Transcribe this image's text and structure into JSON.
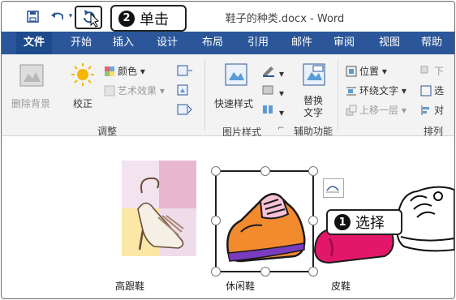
{
  "title_bar": {
    "doc_title": "鞋子的种类.docx - Word",
    "callout_click_num": "2",
    "callout_click_text": "单击"
  },
  "tabs": [
    "文件",
    "开始",
    "插入",
    "设计",
    "布局",
    "引用",
    "邮件",
    "审阅",
    "视图",
    "帮助"
  ],
  "ribbon": {
    "remove_bg": "删除背景",
    "corrections": "校正",
    "color": "颜色",
    "artistic_effects": "艺术效果",
    "quick_styles": "快速样式",
    "alt_text_line1": "替换",
    "alt_text_line2": "文字",
    "position": "位置",
    "wrap_text": "环绕文字",
    "bring_forward": "上移一层",
    "next_cut_1": "下",
    "next_cut_2": "选",
    "next_cut_3": "对",
    "group_adjust": "调整",
    "group_picture_styles": "图片样式",
    "group_accessibility": "辅助功能",
    "group_arrange": "排列"
  },
  "content": {
    "caption_high_heel": "高跟鞋",
    "caption_casual": "休闲鞋",
    "caption_leather": "皮鞋",
    "callout_select_num": "1",
    "callout_select_text": "选择"
  },
  "colors": {
    "accent": "#2b579a",
    "file_tab": "#1d4a8c",
    "ribbon_bg": "#f3f3f3"
  }
}
